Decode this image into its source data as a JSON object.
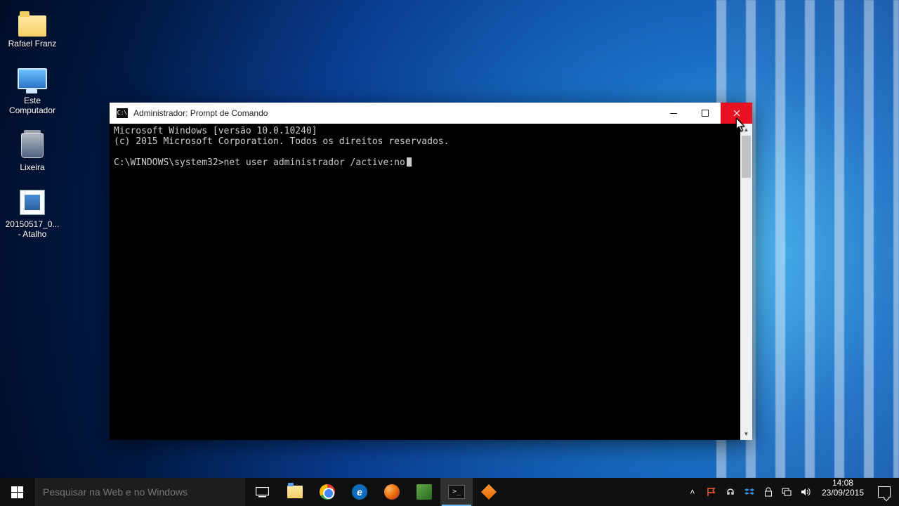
{
  "desktop": {
    "icons": [
      {
        "label": "Rafael Franz",
        "kind": "folder"
      },
      {
        "label": "Este\nComputador",
        "kind": "pc"
      },
      {
        "label": "Lixeira",
        "kind": "bin"
      },
      {
        "label": "20150517_0...\n- Atalho",
        "kind": "image"
      }
    ]
  },
  "cmd": {
    "title": "Administrador: Prompt de Comando",
    "line1": "Microsoft Windows [versão 10.0.10240]",
    "line2": "(c) 2015 Microsoft Corporation. Todos os direitos reservados.",
    "prompt": "C:\\WINDOWS\\system32>",
    "command": "net user administrador /active:no"
  },
  "taskbar": {
    "search_placeholder": "Pesquisar na Web e no Windows",
    "clock_time": "14:08",
    "clock_date": "23/09/2015"
  },
  "tray_icons": [
    "chevron-up",
    "flag",
    "headset",
    "dropbox",
    "lock",
    "network",
    "volume"
  ]
}
